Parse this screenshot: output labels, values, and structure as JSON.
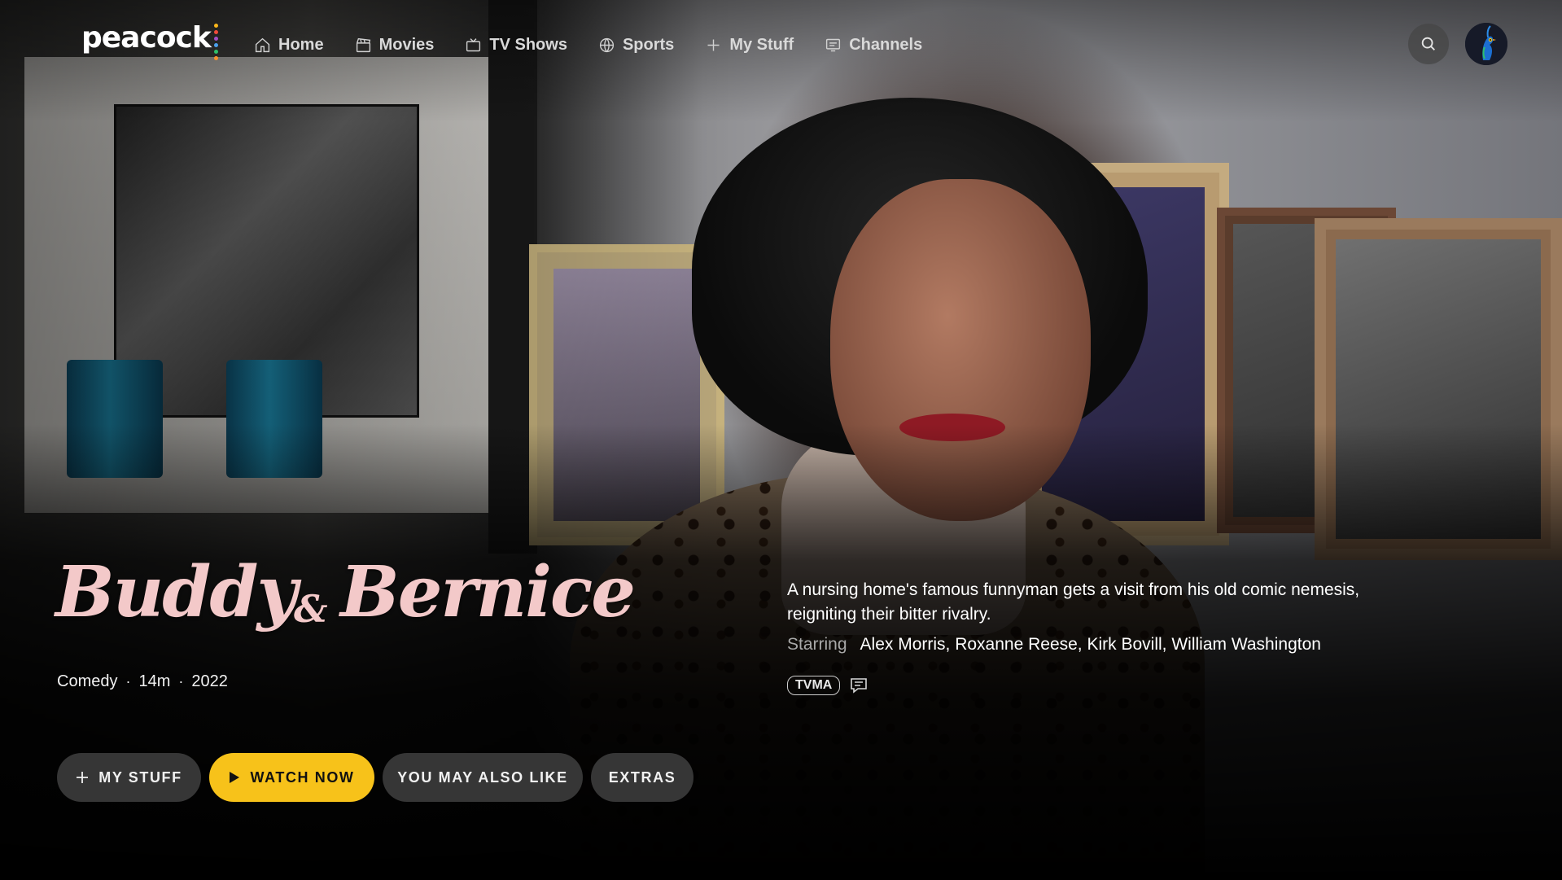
{
  "brand": {
    "name": "peacock",
    "dot_colors": [
      "#f9b61a",
      "#f04a3a",
      "#a24ec8",
      "#4aa0ea",
      "#2fbf6a",
      "#f7932d"
    ]
  },
  "nav": {
    "items": [
      {
        "label": "Home",
        "icon": "home-icon"
      },
      {
        "label": "Movies",
        "icon": "clapperboard-icon"
      },
      {
        "label": "TV Shows",
        "icon": "tv-icon"
      },
      {
        "label": "Sports",
        "icon": "ball-icon"
      },
      {
        "label": "My Stuff",
        "icon": "plus-icon"
      },
      {
        "label": "Channels",
        "icon": "channels-icon"
      }
    ],
    "search_icon": "search-icon",
    "profile_icon": "peacock-avatar-icon"
  },
  "title": {
    "part1": "Buddy",
    "amp": "&",
    "part2": "Bernice"
  },
  "meta": {
    "genre": "Comedy",
    "duration": "14m",
    "year": "2022",
    "separator": "·"
  },
  "details": {
    "description": "A nursing home's famous funnyman gets a visit from his old comic nemesis, reigniting their bitter rivalry.",
    "starring_label": "Starring",
    "starring": "Alex Morris, Roxanne Reese, Kirk Bovill, William Washington",
    "rating": "TVMA",
    "cc_icon": "closed-captions-icon"
  },
  "actions": {
    "my_stuff": "MY STUFF",
    "watch_now": "WATCH NOW",
    "you_may_also_like": "YOU MAY ALSO LIKE",
    "extras": "EXTRAS"
  },
  "colors": {
    "accent": "#f7c21a",
    "title_pink": "#f3c9c9"
  }
}
